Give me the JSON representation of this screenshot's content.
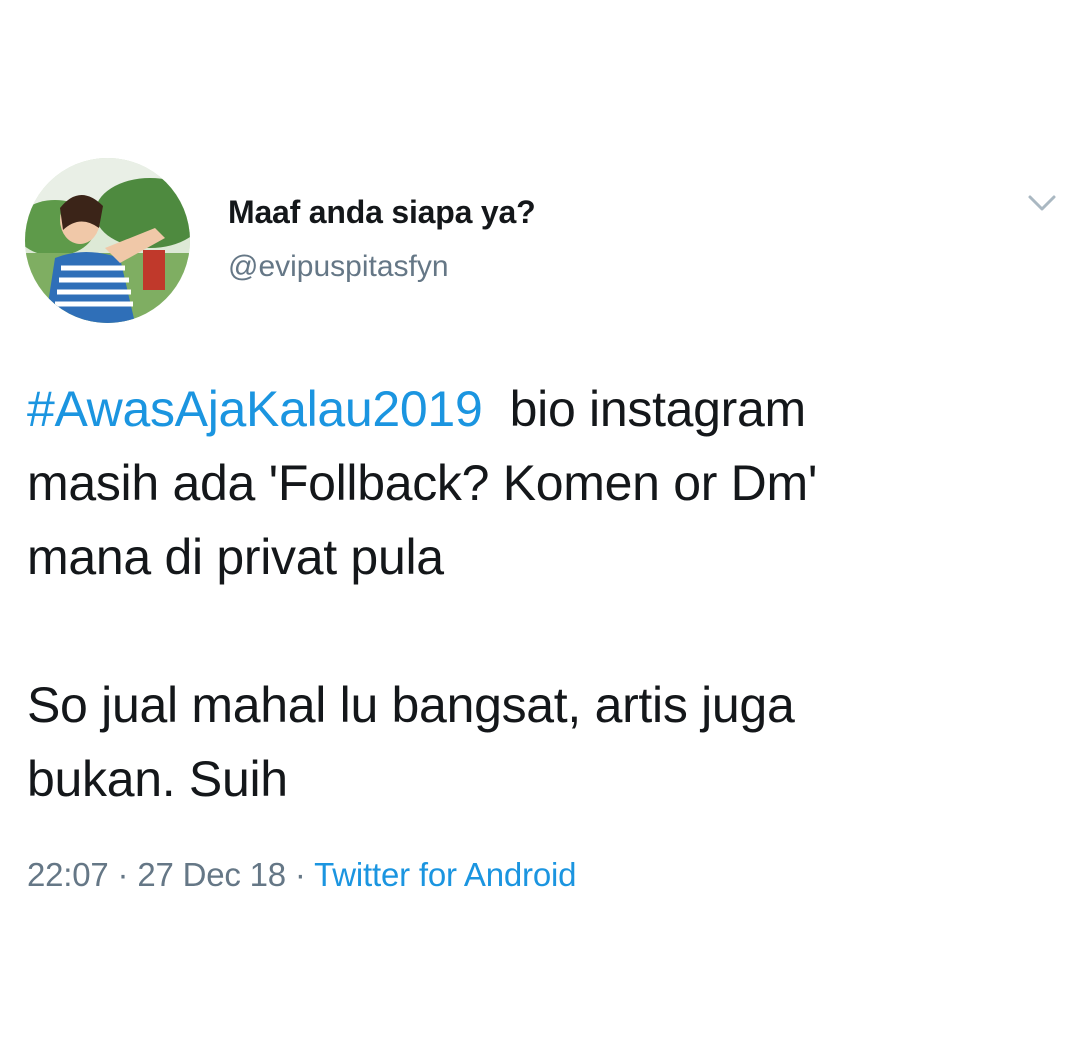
{
  "author": {
    "display_name": "Maaf anda siapa ya?",
    "handle": "@evipuspitasfyn",
    "avatar_icon": "profile-photo"
  },
  "menu": {
    "icon": "chevron-down-icon"
  },
  "tweet": {
    "hashtag": "#AwasAjaKalau2019",
    "line1_rest": "  bio instagram",
    "line2": "masih ada 'Follback? Komen or Dm'",
    "line3": "mana di privat pula",
    "line4": "So jual mahal lu bangsat, artis juga",
    "line5": "bukan. Suih"
  },
  "meta": {
    "time": "22:07",
    "sep1": " · ",
    "date": "27 Dec 18",
    "sep2": " · ",
    "source": "Twitter for Android"
  },
  "colors": {
    "link": "#1b95e0",
    "text": "#14171a",
    "secondary": "#657786"
  }
}
